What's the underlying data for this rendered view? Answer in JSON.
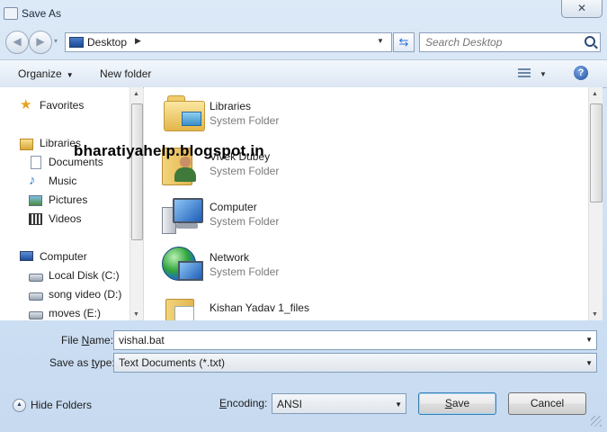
{
  "window": {
    "title": "Save As",
    "close_label": "✕"
  },
  "nav": {
    "back_glyph": "◀",
    "forward_glyph": "▶",
    "history_glyph": "▾",
    "breadcrumb": "Desktop",
    "breadcrumb_arrow": "▶",
    "address_dropdown": "▼",
    "refresh_glyph": "⇆",
    "search_placeholder": "Search Desktop"
  },
  "toolbar": {
    "organize_label": "Organize",
    "new_folder_label": "New folder",
    "caret": "▼",
    "help_label": "?"
  },
  "navpane": {
    "favorites": "Favorites",
    "libraries": "Libraries",
    "documents": "Documents",
    "music": "Music",
    "pictures": "Pictures",
    "videos": "Videos",
    "computer": "Computer",
    "local_disk": "Local Disk (C:)",
    "song_video": "song video (D:)",
    "moves": "moves (E:)"
  },
  "content": {
    "items": [
      {
        "name": "Libraries",
        "type": "System Folder",
        "icon": "libraries-folder-icon"
      },
      {
        "name": "Vivek Dubey",
        "type": "System Folder",
        "icon": "user-folder-icon"
      },
      {
        "name": "Computer",
        "type": "System Folder",
        "icon": "computer-icon"
      },
      {
        "name": "Network",
        "type": "System Folder",
        "icon": "network-icon"
      },
      {
        "name": "Kishan Yadav 1_files",
        "type": "",
        "icon": "folder-icon"
      }
    ],
    "watermark": "bharatiyahelp.blogspot.in"
  },
  "form": {
    "file_name_label_u": "N",
    "file_name_label_pre": "File ",
    "file_name_label_post": "ame:",
    "file_name_value": "vishal.bat",
    "save_type_label_pre": "Save as ",
    "save_type_label_u": "t",
    "save_type_label_post": "ype:",
    "save_type_value": "Text Documents (*.txt)",
    "hide_folders_label": "Hide Folders",
    "encoding_label_u": "E",
    "encoding_label_post": "ncoding:",
    "encoding_value": "ANSI",
    "save_label_u": "S",
    "save_label_post": "ave",
    "cancel_label": "Cancel",
    "dropdown_glyph": "▼"
  },
  "colors": {
    "chrome": "#cfe0f3",
    "accent": "#2a6fd6",
    "selection_border": "#3c7fb1"
  }
}
